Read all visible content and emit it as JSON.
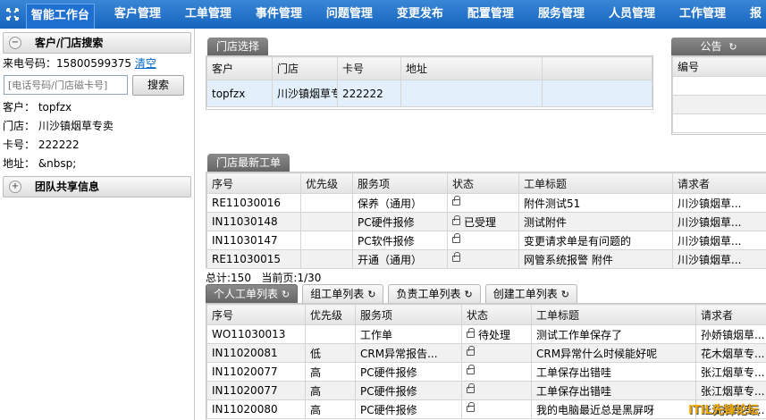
{
  "nav": {
    "items": [
      "智能工作台",
      "客户管理",
      "工单管理",
      "事件管理",
      "问题管理",
      "变更发布",
      "配置管理",
      "服务管理",
      "人员管理",
      "工作管理"
    ],
    "overflow": "报"
  },
  "sidebar": {
    "customer_search_title": "客户/门店搜索",
    "caller_label": "来电号码：",
    "caller_number": "15800599375",
    "clear_link": "清空",
    "search_placeholder": "[电话号码/门店磁卡号]",
    "search_button": "搜索",
    "customer_line": "客户： topfzx",
    "store_line": "门店： 川沙镇烟草专卖",
    "card_line": "卡号： 222222",
    "address_line": "地址： &nbsp;",
    "team_share_title": "团队共享信息"
  },
  "store_select": {
    "tab_label": "门店选择",
    "headers": [
      "客户",
      "门店",
      "卡号",
      "地址"
    ],
    "row": [
      "topfzx",
      "川沙镇烟草专",
      "222222",
      ""
    ]
  },
  "announcement": {
    "tab_label": "公告",
    "header": "编号"
  },
  "latest_orders": {
    "tab_label": "门店最新工单",
    "headers": [
      "序号",
      "优先级",
      "服务项",
      "状态",
      "工单标题",
      "请求者"
    ],
    "rows": [
      {
        "id": "RE11030016",
        "priority": "",
        "service": "保养（通用）",
        "status": "",
        "title": "附件测试51",
        "requester": "川沙镇烟草..."
      },
      {
        "id": "IN11030148",
        "priority": "",
        "service": "PC硬件报修",
        "status": "已受理",
        "title": "测试附件",
        "requester": "川沙镇烟草..."
      },
      {
        "id": "IN11030147",
        "priority": "",
        "service": "PC软件报修",
        "status": "",
        "title": "变更请求单是有问题的",
        "requester": "川沙镇烟草..."
      },
      {
        "id": "RE11030015",
        "priority": "",
        "service": "开通（通用）",
        "status": "",
        "title": "网管系统报警 附件",
        "requester": "川沙镇烟草..."
      }
    ]
  },
  "pagination": {
    "total": "总计:150",
    "current": "当前页:1/30"
  },
  "personal_tabs": [
    "个人工单列表",
    "组工单列表",
    "负责工单列表",
    "创建工单列表"
  ],
  "personal_orders": {
    "headers": [
      "序号",
      "优先级",
      "服务项",
      "状态",
      "工单标题",
      "请求者"
    ],
    "rows": [
      {
        "id": "WO11030013",
        "priority": "",
        "service": "工作单",
        "status": "待处理",
        "title": "测试工作单保存了",
        "requester": "孙娇镇烟草..."
      },
      {
        "id": "IN11020081",
        "priority": "低",
        "service": "CRM异常报告...",
        "status": "",
        "title": "CRM异常什么时候能好呢",
        "requester": "花木烟草专..."
      },
      {
        "id": "IN11020077",
        "priority": "高",
        "service": "PC硬件报修",
        "status": "",
        "title": "工单保存出错哇",
        "requester": "张江烟草专..."
      },
      {
        "id": "IN11020077",
        "priority": "高",
        "service": "PC硬件报修",
        "status": "",
        "title": "工单保存出错哇",
        "requester": "张江烟草专..."
      },
      {
        "id": "IN11020080",
        "priority": "高",
        "service": "PC硬件报修",
        "status": "",
        "title": "我的电脑最近总是黑屏呀",
        "requester": "张江烟草专..."
      }
    ]
  },
  "watermark": "ITIL先锋论坛"
}
